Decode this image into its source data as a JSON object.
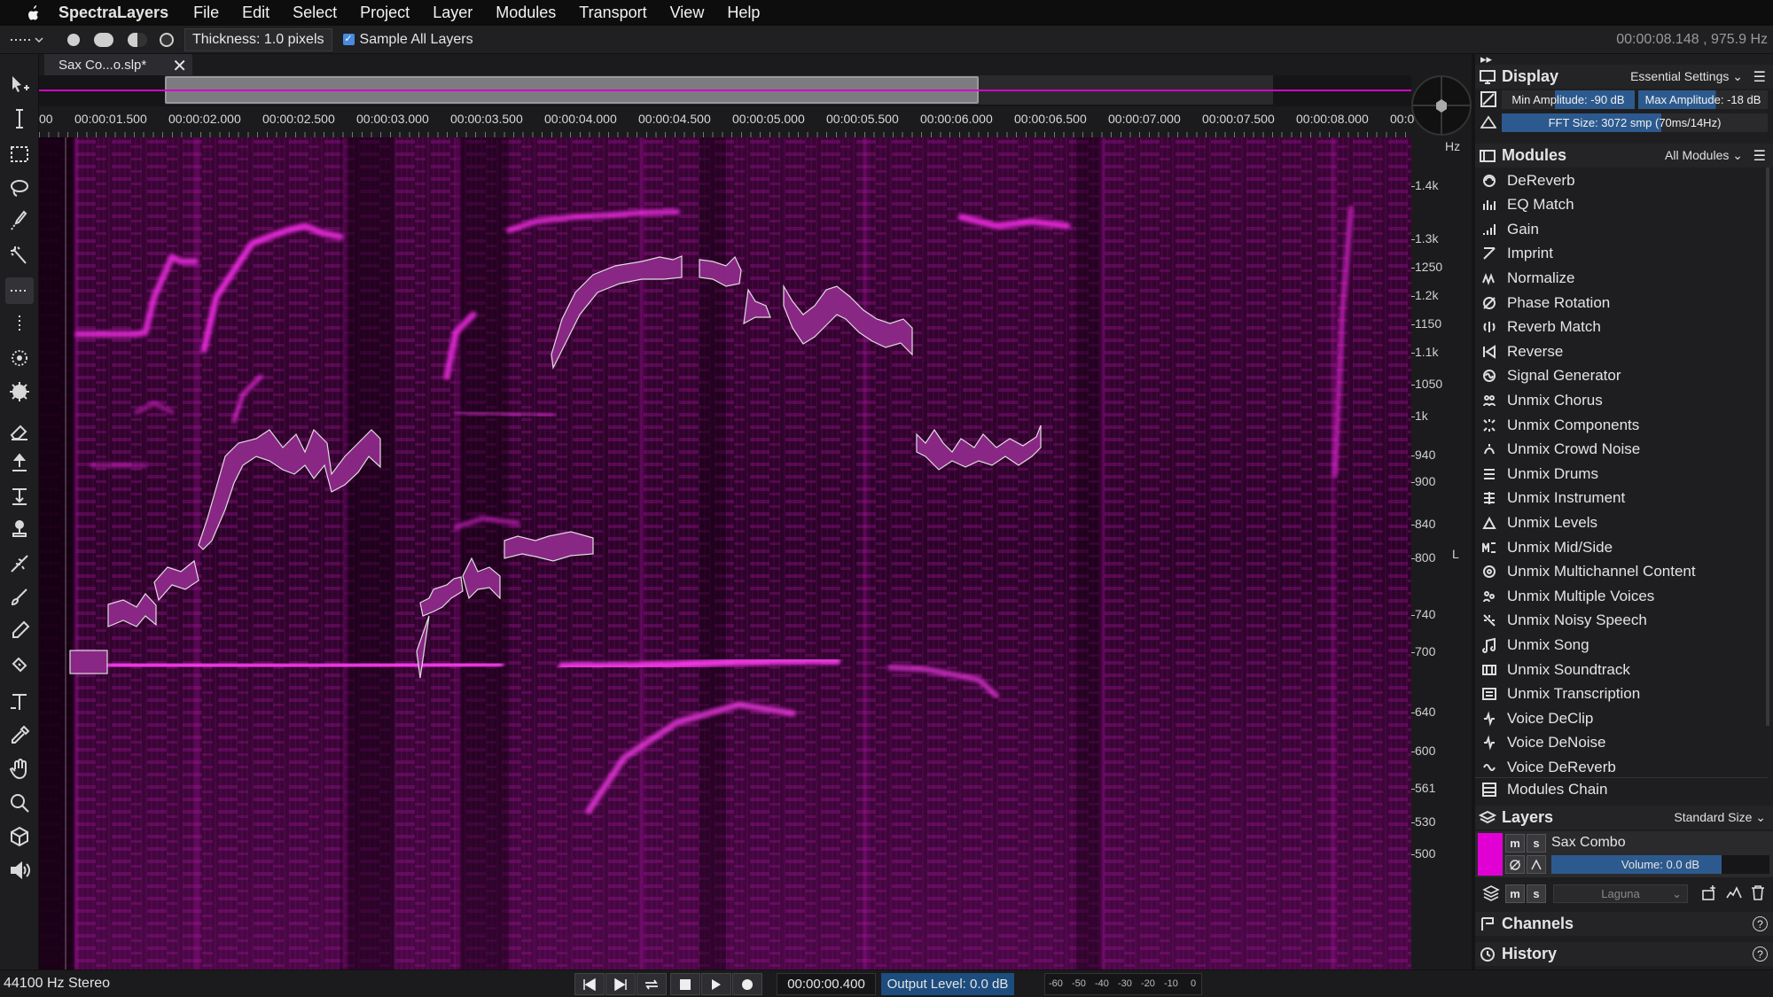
{
  "menubar": {
    "app_name": "SpectraLayers",
    "items": [
      "File",
      "Edit",
      "Select",
      "Project",
      "Layer",
      "Modules",
      "Transport",
      "View",
      "Help"
    ]
  },
  "options_bar": {
    "thickness": "Thickness: 1.0 pixels",
    "sample_all_layers": "Sample All Layers",
    "sample_all_checked": true,
    "time_readout": "00:00:08.148 , 975.9 Hz"
  },
  "document": {
    "tab_title": "Sax Co...o.slp*"
  },
  "ruler": {
    "ticks": [
      "00",
      "00:00:01.500",
      "00:00:02.000",
      "00:00:02.500",
      "00:00:03.000",
      "00:00:03.500",
      "00:00:04.000",
      "00:00:04.500",
      "00:00:05.000",
      "00:00:05.500",
      "00:00:06.000",
      "00:00:06.500",
      "00:00:07.000",
      "00:00:07.500",
      "00:00:08.000",
      "00:0"
    ]
  },
  "freq_scale": {
    "unit": "Hz",
    "channel": "L",
    "labels": [
      "1.4k",
      "1.3k",
      "1250",
      "1.2k",
      "1150",
      "1.1k",
      "1050",
      "1k",
      "940",
      "900",
      "840",
      "800",
      "740",
      "700",
      "640",
      "600",
      "561",
      "530",
      "500"
    ]
  },
  "display_panel": {
    "title": "Display",
    "preset": "Essential Settings",
    "min_amplitude": "Min Amplitude: -90 dB",
    "max_amplitude": "Max Amplitude: -18 dB",
    "fft_size": "FFT Size: 3072 smp (70ms/14Hz)"
  },
  "modules_panel": {
    "title": "Modules",
    "filter": "All Modules",
    "items": [
      {
        "label": "DeReverb",
        "icon": "dereverb-icon"
      },
      {
        "label": "EQ Match",
        "icon": "eq-match-icon"
      },
      {
        "label": "Gain",
        "icon": "gain-icon"
      },
      {
        "label": "Imprint",
        "icon": "imprint-icon"
      },
      {
        "label": "Normalize",
        "icon": "normalize-icon"
      },
      {
        "label": "Phase Rotation",
        "icon": "phase-rotation-icon"
      },
      {
        "label": "Reverb Match",
        "icon": "reverb-match-icon"
      },
      {
        "label": "Reverse",
        "icon": "reverse-icon"
      },
      {
        "label": "Signal Generator",
        "icon": "signal-generator-icon"
      },
      {
        "label": "Unmix Chorus",
        "icon": "unmix-chorus-icon"
      },
      {
        "label": "Unmix Components",
        "icon": "unmix-components-icon"
      },
      {
        "label": "Unmix Crowd Noise",
        "icon": "unmix-crowd-noise-icon"
      },
      {
        "label": "Unmix Drums",
        "icon": "unmix-drums-icon"
      },
      {
        "label": "Unmix Instrument",
        "icon": "unmix-instrument-icon"
      },
      {
        "label": "Unmix Levels",
        "icon": "unmix-levels-icon"
      },
      {
        "label": "Unmix Mid/Side",
        "icon": "unmix-mid-side-icon"
      },
      {
        "label": "Unmix Multichannel Content",
        "icon": "unmix-multichannel-icon"
      },
      {
        "label": "Unmix Multiple Voices",
        "icon": "unmix-multiple-voices-icon"
      },
      {
        "label": "Unmix Noisy Speech",
        "icon": "unmix-noisy-speech-icon"
      },
      {
        "label": "Unmix Song",
        "icon": "unmix-song-icon"
      },
      {
        "label": "Unmix Soundtrack",
        "icon": "unmix-soundtrack-icon"
      },
      {
        "label": "Unmix Transcription",
        "icon": "unmix-transcription-icon"
      },
      {
        "label": "Voice DeClip",
        "icon": "voice-declip-icon"
      },
      {
        "label": "Voice DeNoise",
        "icon": "voice-denoise-icon"
      },
      {
        "label": "Voice DeReverb",
        "icon": "voice-dereverb-icon"
      }
    ],
    "chain_label": "Modules Chain"
  },
  "layers_panel": {
    "title": "Layers",
    "size": "Standard Size",
    "layer_name": "Sax Combo",
    "volume": "Volume: 0.0 dB",
    "mute": "m",
    "solo": "s",
    "blend_mode": "Laguna"
  },
  "channels_panel": {
    "title": "Channels"
  },
  "history_panel": {
    "title": "History"
  },
  "status": {
    "sample_rate": "44100 Hz Stereo",
    "current_time": "00:00:00.400",
    "output_level": "Output Level: 0.0 dB",
    "meter_scale": [
      "-60",
      "-50",
      "-40",
      "-30",
      "-20",
      "-10",
      "0"
    ]
  },
  "colors": {
    "accent_magenta": "#d400c8",
    "selection_blue": "#2c5a8e",
    "spectrogram_bg": "#1a0016"
  }
}
